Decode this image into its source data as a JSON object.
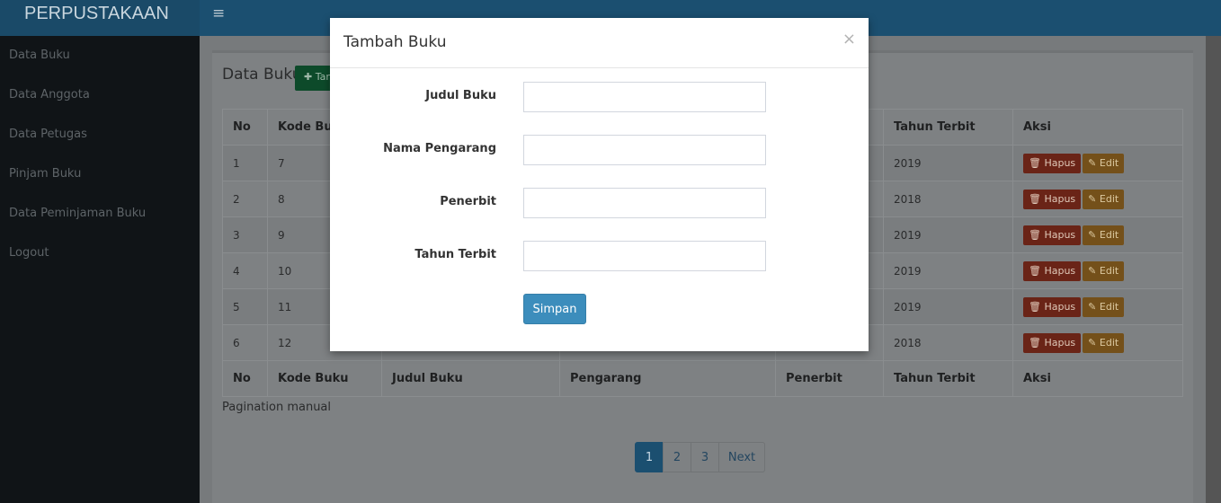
{
  "app": {
    "brand": "PERPUSTAKAAN",
    "menu_toggle_icon": "≡"
  },
  "sidebar": {
    "items": [
      {
        "label": "Data Buku"
      },
      {
        "label": "Data Anggota"
      },
      {
        "label": "Data Petugas"
      },
      {
        "label": "Pinjam Buku"
      },
      {
        "label": "Data Peminjaman Buku"
      },
      {
        "label": "Logout"
      }
    ]
  },
  "main": {
    "title": "Data Buku",
    "add_button": "✚ Tambah",
    "table": {
      "headers": [
        "No",
        "Kode Buku",
        "Judul Buku",
        "Pengarang",
        "Penerbit",
        "Tahun Terbit",
        "Aksi"
      ],
      "rows": [
        {
          "no": "1",
          "kode": "7",
          "tahun": "2019"
        },
        {
          "no": "2",
          "kode": "8",
          "tahun": "2018"
        },
        {
          "no": "3",
          "kode": "9",
          "tahun": "2019"
        },
        {
          "no": "4",
          "kode": "10",
          "tahun": "2019"
        },
        {
          "no": "5",
          "kode": "11",
          "tahun": "2019"
        },
        {
          "no": "6",
          "kode": "12",
          "tahun": "2018"
        }
      ],
      "delete_label": "🗑 Hapus",
      "edit_label": "✎ Edit"
    },
    "pagination_note": "Pagination manual",
    "pagination": {
      "pages": [
        "1",
        "2",
        "3"
      ],
      "next": "Next",
      "active": "1"
    }
  },
  "modal": {
    "title": "Tambah Buku",
    "close": "×",
    "fields": [
      {
        "label": "Judul Buku",
        "value": "",
        "placeholder": ""
      },
      {
        "label": "Nama Pengarang",
        "value": "",
        "placeholder": ""
      },
      {
        "label": "Penerbit",
        "value": "",
        "placeholder": ""
      },
      {
        "label": "Tahun Terbit",
        "value": "",
        "placeholder": ""
      }
    ],
    "submit": "Simpan"
  },
  "colors": {
    "header": "#3c8dbc",
    "sidebar": "#222d32",
    "primary_button": "#3c8dbc",
    "danger": "#dd4b39",
    "warning": "#f39c12",
    "success": "#00a65a"
  },
  "icons": [
    "menu-icon",
    "plus-icon",
    "trash-icon",
    "pencil-icon",
    "close-icon"
  ]
}
